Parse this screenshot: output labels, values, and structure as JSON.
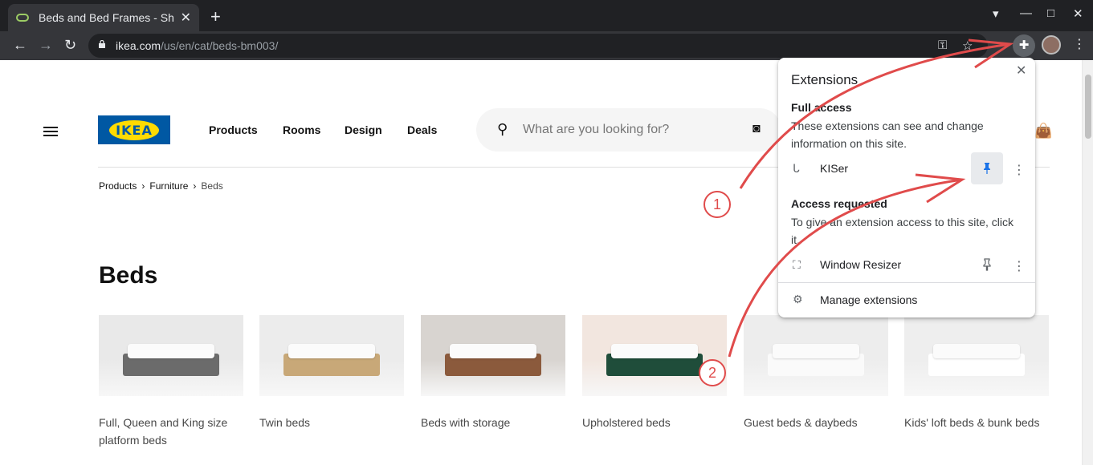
{
  "browser": {
    "tab_title": "Beds and Bed Frames - Sh",
    "tab_close": "✕",
    "new_tab": "+",
    "url_host": "ikea.com",
    "url_path": "/us/en/cat/beds-bm003/",
    "window_controls": [
      "▾",
      "—",
      "□",
      "✕"
    ]
  },
  "site": {
    "logo_text": "IKEA",
    "nav": [
      "Products",
      "Rooms",
      "Design",
      "Deals"
    ],
    "search_placeholder": "What are you looking for?",
    "breadcrumb": [
      "Products",
      "Furniture",
      "Beds"
    ],
    "page_title": "Beds",
    "categories": [
      {
        "label_line1": "Full, Queen and King size",
        "label_line2": "platform beds",
        "colors": [
          "#e9e9e9",
          "#6b6b6b"
        ]
      },
      {
        "label_line1": "Twin beds",
        "label_line2": "",
        "colors": [
          "#ececec",
          "#c8a878"
        ]
      },
      {
        "label_line1": "Beds with storage",
        "label_line2": "",
        "colors": [
          "#d8d4d0",
          "#8b5a3c"
        ]
      },
      {
        "label_line1": "Upholstered beds",
        "label_line2": "",
        "colors": [
          "#f2e6df",
          "#1f4d3a"
        ]
      },
      {
        "label_line1": "Guest beds & daybeds",
        "label_line2": "",
        "colors": [
          "#ededed",
          "#fafafa"
        ]
      },
      {
        "label_line1": "Kids' loft beds & bunk beds",
        "label_line2": "",
        "colors": [
          "#eeeeee",
          "#ffffff"
        ]
      }
    ]
  },
  "extensions_popup": {
    "title": "Extensions",
    "full_access_heading": "Full access",
    "full_access_desc": "These extensions can see and change information on this site.",
    "full_access_items": [
      {
        "name": "KISer",
        "pinned": true
      }
    ],
    "requested_heading": "Access requested",
    "requested_desc": "To give an extension access to this site, click it.",
    "requested_items": [
      {
        "name": "Window Resizer",
        "pinned": false
      }
    ],
    "manage_label": "Manage extensions"
  },
  "annotations": {
    "callout_1": "1",
    "callout_2": "2",
    "arrow_color": "#e04b4b"
  }
}
